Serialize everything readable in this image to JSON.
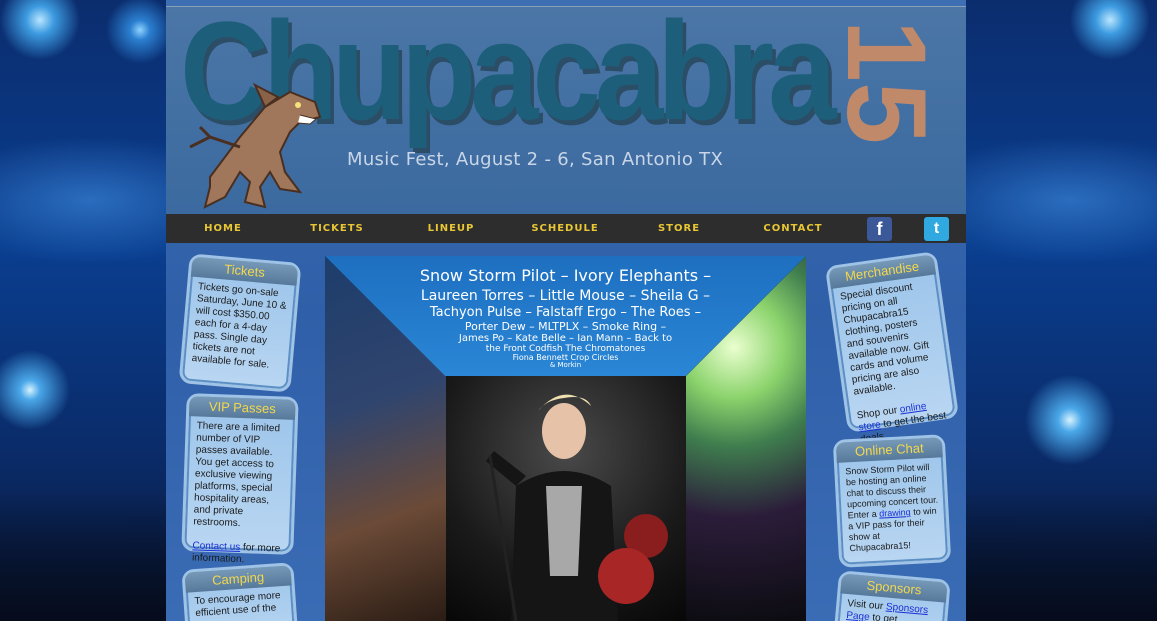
{
  "site": {
    "title": "Chupacabra",
    "year_mark": "15",
    "tagline": "Music Fest, August 2 - 6, San Antonio TX"
  },
  "nav": {
    "items": [
      "HOME",
      "TICKETS",
      "LINEUP",
      "SCHEDULE",
      "STORE",
      "CONTACT"
    ],
    "facebook": "f",
    "twitter": "t"
  },
  "left_boxes": {
    "tickets": {
      "title": "Tickets",
      "text": "Tickets go on-sale Saturday, June 10 & will cost $350.00 each for a 4-day pass. Single day tickets are not available for sale."
    },
    "vip": {
      "title": "VIP Passes",
      "text": "There are a limited number of VIP passes available. You get access to exclusive viewing platforms, special hospitality areas, and private restrooms.",
      "link": "Contact us",
      "after": " for more information."
    },
    "camping": {
      "title": "Camping",
      "text": "To encourage more efficient use of the space"
    }
  },
  "right_boxes": {
    "merch": {
      "title": "Merchandise",
      "text": "Special discount pricing on all Chupacabra15 clothing, posters and souvenirs available now. Gift cards and volume pricing are also available.",
      "shop": "Shop our ",
      "link": "online store",
      "after": " to get the best deals."
    },
    "chat": {
      "title": "Online Chat",
      "text": "Snow Storm Pilot will be hosting an online chat to discuss their upcoming concert tour. Enter a ",
      "link": "drawing",
      "after": " to win a VIP pass for their show at Chupacabra15!"
    },
    "sponsors": {
      "title": "Sponsors",
      "text": "Visit our ",
      "link": "Sponsors Page",
      "after": " to get"
    }
  },
  "lineup": {
    "row1": "Snow Storm Pilot – Ivory Elephants –",
    "row2": "Laureen Torres – Little Mouse – Sheila G –",
    "row3": "Tachyon Pulse – Falstaff Ergo – The Roes –",
    "row4": "Porter Dew – MLTPLX – Smoke Ring –",
    "row5": "James Po – Kate Belle – Ian Mann – Back to",
    "row6": "the Front  Codfish  The Chromatones",
    "row7": "Fiona Bennett  Crop Circles",
    "row8": "& Morkin"
  },
  "colors": {
    "nav_bg": "#2d2d2d",
    "nav_text": "#e8c634",
    "title_blue": "#1d5f7a",
    "year_color": "#c08a6a",
    "box_title": "#f2d84a",
    "link": "#1a2fd6"
  }
}
